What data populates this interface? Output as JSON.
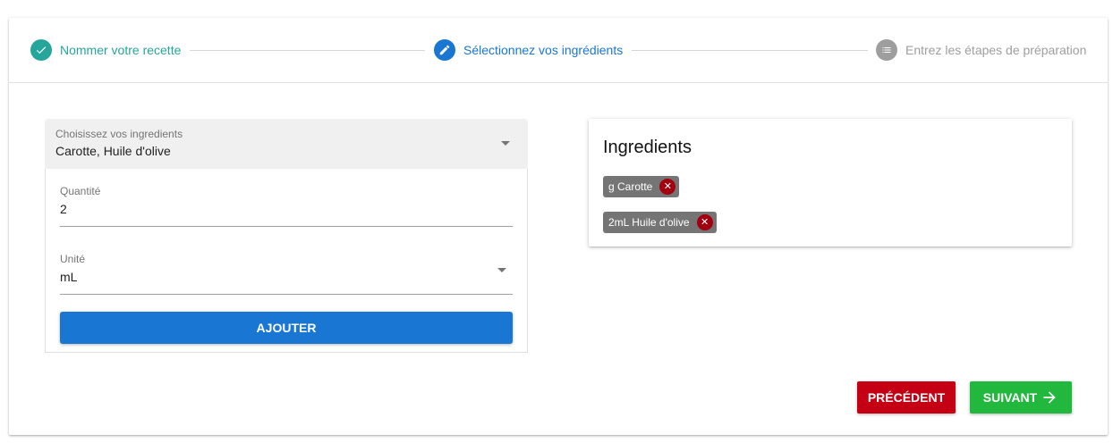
{
  "stepper": {
    "steps": [
      {
        "label": "Nommer votre recette",
        "icon": "check-icon",
        "state": "completed",
        "color": "#26a69a"
      },
      {
        "label": "Sélectionnez vos ingrédients",
        "icon": "pencil-icon",
        "state": "active",
        "color": "#1976d2"
      },
      {
        "label": "Entrez les étapes de préparation",
        "icon": "list-icon",
        "state": "pending",
        "color": "#9e9e9e"
      }
    ]
  },
  "ingredient_select": {
    "label": "Choisissez vos ingredients",
    "value": "Carotte, Huile d'olive"
  },
  "quantity": {
    "label": "Quantité",
    "value": "2"
  },
  "unit": {
    "label": "Unité",
    "value": "mL"
  },
  "add_button": {
    "label": "AJOUTER",
    "color": "#1976d2"
  },
  "ingredients_panel": {
    "title": "Ingredients",
    "chips": [
      {
        "label": "g Carotte",
        "remove_icon": "close-icon"
      },
      {
        "label": "2mL Huile d'olive",
        "remove_icon": "close-icon"
      }
    ]
  },
  "nav": {
    "previous_label": "PRÉCÉDENT",
    "previous_color": "#c50014",
    "next_label": "SUIVANT",
    "next_icon": "arrow-right-icon",
    "next_color": "#22b83e"
  }
}
